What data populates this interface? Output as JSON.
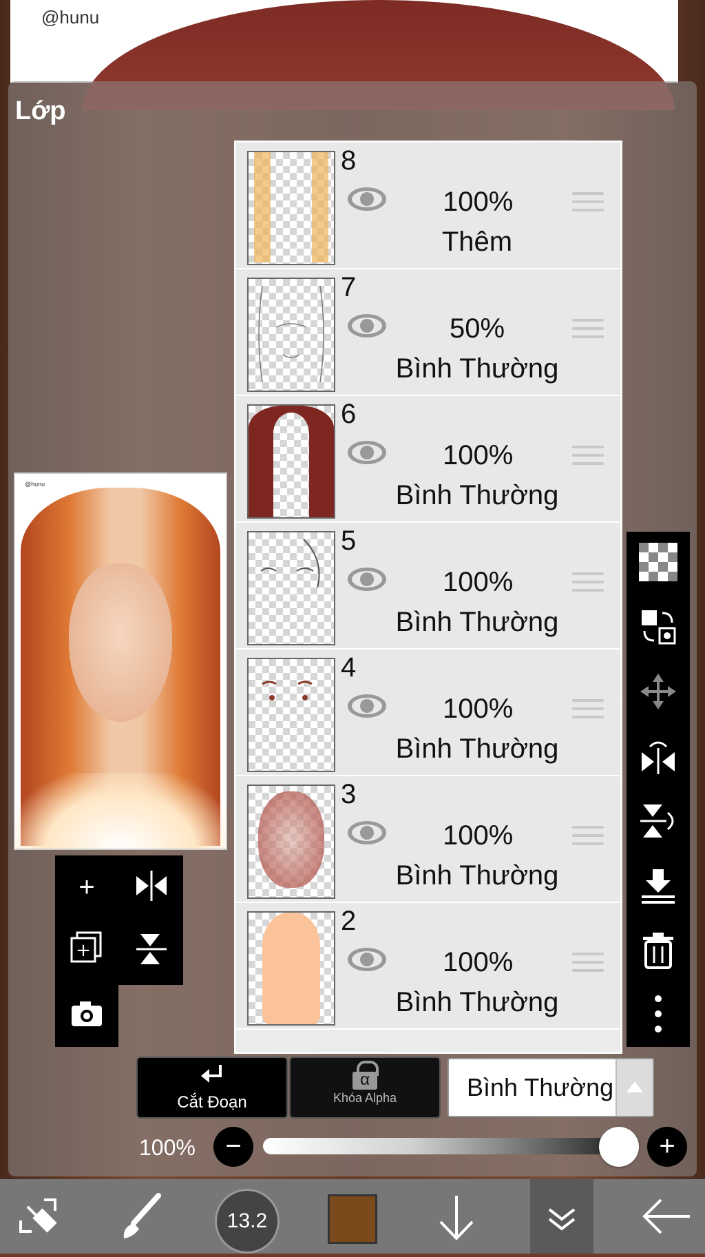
{
  "canvas": {
    "watermark": "@hunu"
  },
  "panel": {
    "title": "Lớp"
  },
  "preview": {
    "watermark": "@hunu"
  },
  "layers": [
    {
      "number": "8",
      "opacity": "100%",
      "mode": "Thêm"
    },
    {
      "number": "7",
      "opacity": "50%",
      "mode": "Bình Thường"
    },
    {
      "number": "6",
      "opacity": "100%",
      "mode": "Bình Thường"
    },
    {
      "number": "5",
      "opacity": "100%",
      "mode": "Bình Thường"
    },
    {
      "number": "4",
      "opacity": "100%",
      "mode": "Bình Thường"
    },
    {
      "number": "3",
      "opacity": "100%",
      "mode": "Bình Thường"
    },
    {
      "number": "2",
      "opacity": "100%",
      "mode": "Bình Thường"
    }
  ],
  "controls": {
    "clip_label": "Cắt Đoạn",
    "alpha_lock_label": "Khóa Alpha",
    "alpha_symbol": "α",
    "blend_mode": "Bình Thường",
    "opacity_label": "100%",
    "opacity_value": 1.0
  },
  "toolbar": {
    "brush_size": "13.2",
    "color": "#7a4a1a"
  },
  "icons": {
    "left_tools": [
      "add-layer-icon",
      "flip-horizontal-icon",
      "duplicate-layer-icon",
      "flip-vertical-icon",
      "camera-icon"
    ],
    "right_tools": [
      "checker-icon",
      "swap-icon",
      "move-icon",
      "flip-horizontal-icon",
      "flip-vertical-icon",
      "merge-down-icon",
      "trash-icon",
      "more-icon"
    ],
    "toolbar": [
      "transform-icon",
      "brush-icon",
      "brush-size-icon",
      "color-icon",
      "download-icon",
      "layers-icon",
      "back-icon"
    ]
  }
}
